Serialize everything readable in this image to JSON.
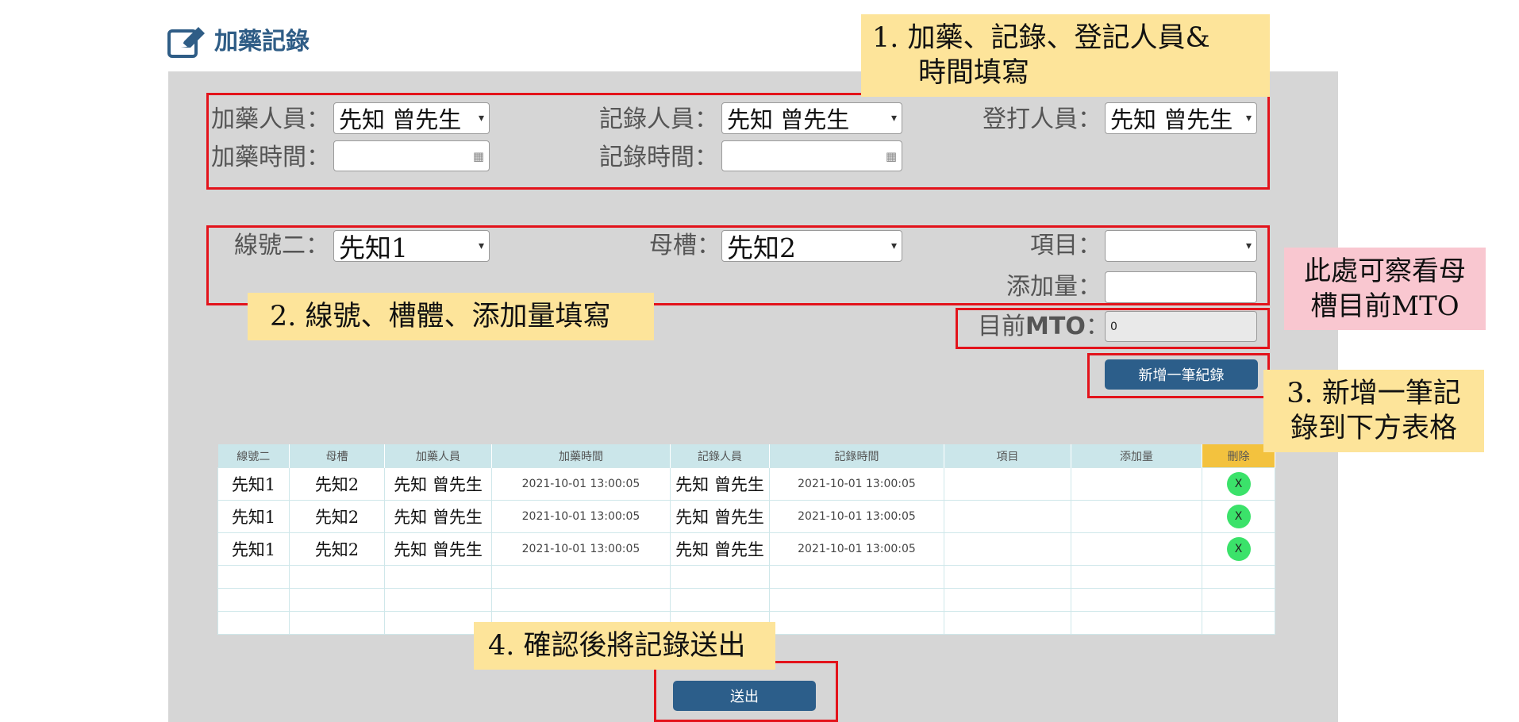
{
  "header": {
    "title": "加藥記錄",
    "icon": "edit-icon"
  },
  "staff": {
    "dosing_person_label": "加藥人員：",
    "dosing_person_value": "先知 曾先生",
    "recorder_label": "記錄人員：",
    "recorder_value": "先知 曾先生",
    "registrar_label": "登打人員：",
    "registrar_value": "先知 曾先生",
    "dosing_time_label": "加藥時間：",
    "dosing_time_value": "",
    "record_time_label": "記錄時間：",
    "record_time_value": ""
  },
  "line": {
    "line_label": "線號二：",
    "line_value": "先知1",
    "tank_label": "母槽：",
    "tank_value": "先知2",
    "item_label": "項目：",
    "item_value": "",
    "amount_label": "添加量：",
    "amount_value": "",
    "mto_label_prefix": "目前",
    "mto_label_bold": "MTO",
    "mto_label_suffix": "：",
    "mto_value": "0"
  },
  "buttons": {
    "add_record": "新增一筆紀錄",
    "submit": "送出"
  },
  "table": {
    "headers": [
      "線號二",
      "母槽",
      "加藥人員",
      "加藥時間",
      "記錄人員",
      "記錄時間",
      "項目",
      "添加量",
      "刪除"
    ],
    "rows": [
      [
        "先知1",
        "先知2",
        "先知 曾先生",
        "2021-10-01 13:00:05",
        "先知 曾先生",
        "2021-10-01 13:00:05",
        "",
        "",
        "X"
      ],
      [
        "先知1",
        "先知2",
        "先知 曾先生",
        "2021-10-01 13:00:05",
        "先知 曾先生",
        "2021-10-01 13:00:05",
        "",
        "",
        "X"
      ],
      [
        "先知1",
        "先知2",
        "先知 曾先生",
        "2021-10-01 13:00:05",
        "先知 曾先生",
        "2021-10-01 13:00:05",
        "",
        "",
        "X"
      ]
    ]
  },
  "annotations": {
    "step1_line1": "1.  加藥、記錄、登記人員&",
    "step1_line2": "時間填寫",
    "step2": "2. 線號、槽體、添加量填寫",
    "mto_note_line1": "此處可察看母",
    "mto_note_line2": "槽目前MTO",
    "step3_line1": "3. 新增一筆記",
    "step3_line2": "錄到下方表格",
    "step4": "4. 確認後將記錄送出"
  },
  "colors": {
    "accent": "#2c5e8a",
    "panel": "#d6d6d6",
    "annotation_border": "#e3131b",
    "note_yellow": "#fde49a",
    "note_pink": "#f9c7d0",
    "delete_button": "#3be26a",
    "table_header": "#cbe6ea",
    "delete_header": "#f3c23e"
  }
}
